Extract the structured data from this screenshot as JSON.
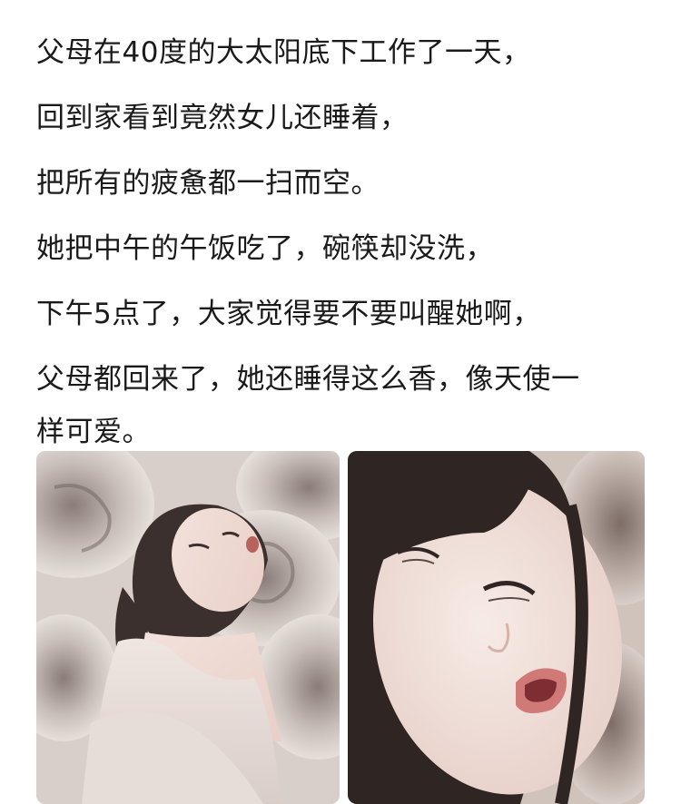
{
  "post": {
    "lines": [
      "父母在40度的大太阳底下工作了一天，",
      "回到家看到竟然女儿还睡着，",
      "把所有的疲惫都一扫而空。",
      "她把中午的午饭吃了，碗筷却没洗，",
      "下午5点了，大家觉得要不要叫醒她啊，",
      "父母都回来了，她还睡得这么香，像天使一",
      "样可爱。"
    ]
  },
  "images": {
    "left": "sleeping-girl-photo",
    "right": "sleeping-girl-closeup-photo"
  }
}
